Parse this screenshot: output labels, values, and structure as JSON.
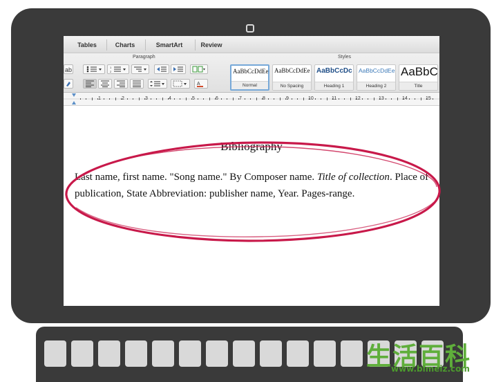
{
  "ribbon": {
    "tabs": [
      "Tables",
      "Charts",
      "SmartArt",
      "Review"
    ],
    "groups": {
      "paragraph": "Paragraph",
      "styles": "Styles"
    },
    "styles": [
      {
        "sample": "AaBbCcDdEe",
        "name": "Normal",
        "selected": true
      },
      {
        "sample": "AaBbCcDdEe",
        "name": "No Spacing"
      },
      {
        "sample": "AaBbCcDc",
        "name": "Heading 1",
        "color": "#1f4e87"
      },
      {
        "sample": "AaBbCcDdEe",
        "name": "Heading 2",
        "color": "#3d7ab8"
      },
      {
        "sample": "AaBbC",
        "name": "Title"
      }
    ]
  },
  "ruler": {
    "labels": [
      "1",
      "2",
      "3",
      "4",
      "5",
      "6",
      "7",
      "8",
      "9",
      "10",
      "11",
      "12",
      "13",
      "14",
      "15"
    ]
  },
  "document": {
    "title": "Bibliography",
    "entry": {
      "before": "Last name, first name. \"Song name.\" By Composer name. ",
      "italic": "Title of collection",
      "after": ". Place of publication, State Abbreviation: publisher name, Year. Pages-range."
    }
  },
  "highlight_color": "#c8194a",
  "watermark": {
    "cjk": "生活百科",
    "url": "www.bimeiz.com"
  }
}
